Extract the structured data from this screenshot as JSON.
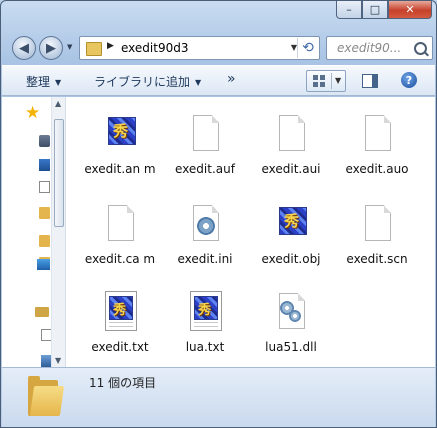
{
  "window": {
    "caption_buttons": {
      "minimize": "–",
      "maximize": "□",
      "close": "✕"
    }
  },
  "navigation": {
    "back": "◀",
    "forward": "▶",
    "address_path": "exedit90d3",
    "search_placeholder": "exedit90..."
  },
  "toolbar": {
    "organize": "整理",
    "include_in_library": "ライブラリに追加",
    "more": "»"
  },
  "files": [
    {
      "name": "exedit.an m",
      "icon": "exedit-app-icon"
    },
    {
      "name": "exedit.auf",
      "icon": "blank-file-icon"
    },
    {
      "name": "exedit.aui",
      "icon": "blank-file-icon"
    },
    {
      "name": "exedit.auo",
      "icon": "blank-file-icon"
    },
    {
      "name": "exedit.ca m",
      "icon": "blank-file-icon"
    },
    {
      "name": "exedit.ini",
      "icon": "settings-file-icon"
    },
    {
      "name": "exedit.obj",
      "icon": "exedit-app-icon"
    },
    {
      "name": "exedit.scn",
      "icon": "blank-file-icon"
    },
    {
      "name": "exedit.txt",
      "icon": "text-file-icon"
    },
    {
      "name": "lua.txt",
      "icon": "text-file-icon"
    },
    {
      "name": "lua51.dll",
      "icon": "dll-file-icon"
    }
  ],
  "status": {
    "item_count": "11 個の項目"
  }
}
